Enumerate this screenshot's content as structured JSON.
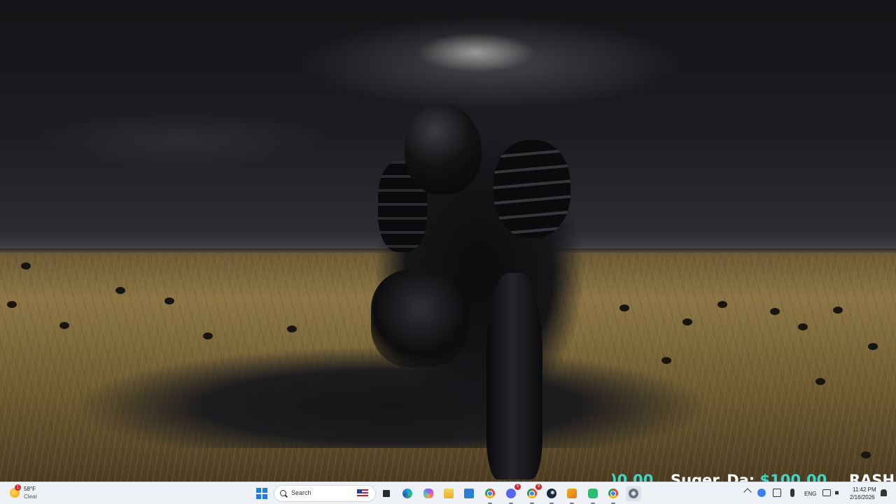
{
  "desktop": {
    "overlay": {
      "fragment_left": ")0.00",
      "donor_name": "Suqer_Da:",
      "donor_amount": "$100.00",
      "fragment_right": "RASH"
    }
  },
  "taskbar": {
    "weather": {
      "temperature": "58°F",
      "condition": "Clear",
      "alert_count": "1",
      "icon": "moon-weather-icon"
    },
    "start_icon": "windows-start-icon",
    "search": {
      "placeholder": "Search",
      "flag_icon": "us-flag-icon"
    },
    "apps": [
      {
        "name": "task-view",
        "icon": "task-view-icon",
        "color": "#2b2b2b"
      },
      {
        "name": "edge",
        "icon": "edge-browser-icon",
        "color": "#1aa0e0"
      },
      {
        "name": "copilot",
        "icon": "copilot-icon",
        "color": "#8a5cf6"
      },
      {
        "name": "file-explorer",
        "icon": "folder-icon",
        "color": "#f3c033"
      },
      {
        "name": "microsoft-store",
        "icon": "store-icon",
        "color": "#2a7fd4"
      },
      {
        "name": "chrome",
        "icon": "chrome-icon",
        "color": "#e04b3a"
      },
      {
        "name": "discord",
        "icon": "discord-icon",
        "color": "#5865f2",
        "badge": "5"
      },
      {
        "name": "chrome-profile",
        "icon": "chrome-icon",
        "color": "#f4b400",
        "badge": "9"
      },
      {
        "name": "steam",
        "icon": "steam-icon",
        "color": "#1b2838"
      },
      {
        "name": "app-yellow",
        "icon": "app-icon",
        "color": "#f2b11c"
      },
      {
        "name": "app-green",
        "icon": "app-icon",
        "color": "#2dbd6e"
      },
      {
        "name": "chrome-active",
        "icon": "chrome-icon",
        "color": "#4285f4"
      },
      {
        "name": "settings",
        "icon": "gear-icon",
        "color": "#6b7280"
      }
    ],
    "tray": {
      "language": "ENG",
      "time": "11:42 PM",
      "date": "2/16/2026"
    }
  }
}
